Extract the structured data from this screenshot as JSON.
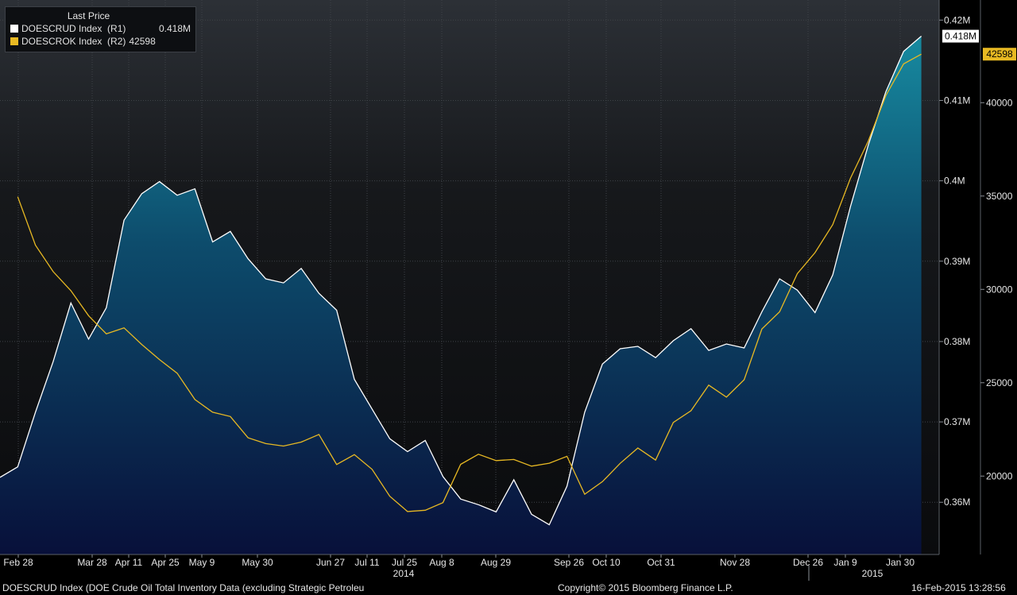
{
  "legend": {
    "header": "Last Price",
    "items": [
      {
        "name": "DOESCRUD Index  (R1)",
        "value": "0.418M",
        "color": "#ffffff"
      },
      {
        "name": "DOESCROK Index  (R2)",
        "value": "42598",
        "color": "#e8b923"
      }
    ]
  },
  "footer": {
    "left": "DOESCRUD Index (DOE Crude Oil Total Inventory Data (excluding Strategic Petroleu",
    "center": "Copyright© 2015 Bloomberg Finance L.P.",
    "right": "16-Feb-2015 13:28:56"
  },
  "chart_data": {
    "type": "area",
    "x_ticks": [
      "Feb 28",
      "Mar 28",
      "Apr 11",
      "Apr 25",
      "May 9",
      "May 30",
      "Jun 27",
      "Jul 11",
      "Jul 25",
      "Aug 8",
      "Aug 29",
      "Sep 26",
      "Oct 10",
      "Oct 31",
      "Nov 28",
      "Dec 26",
      "Jan 9",
      "Jan 30"
    ],
    "year_labels": [
      "2014",
      "2015"
    ],
    "left_axis": {
      "min": 0.3535,
      "max": 0.4225,
      "ticks": [
        "0.36M",
        "0.37M",
        "0.38M",
        "0.39M",
        "0.4M",
        "0.41M",
        "0.42M"
      ]
    },
    "right_axis": {
      "min": 15800,
      "max": 45500,
      "ticks": [
        "20000",
        "25000",
        "30000",
        "35000",
        "40000"
      ]
    },
    "series": [
      {
        "name": "DOESCRUD Index  (R1)",
        "axis": "left",
        "color": "#ffffff",
        "last_label": "0.418M",
        "values": [
          0.3631,
          0.3644,
          0.3712,
          0.3775,
          0.3848,
          0.3803,
          0.3842,
          0.3951,
          0.3984,
          0.3999,
          0.3982,
          0.399,
          0.3924,
          0.3937,
          0.3903,
          0.3878,
          0.3873,
          0.3891,
          0.386,
          0.3839,
          0.3753,
          0.3716,
          0.3679,
          0.3663,
          0.3677,
          0.3632,
          0.3604,
          0.3597,
          0.3588,
          0.3628,
          0.3585,
          0.3572,
          0.362,
          0.3712,
          0.3772,
          0.3791,
          0.3794,
          0.378,
          0.3801,
          0.3816,
          0.3789,
          0.3797,
          0.3792,
          0.3837,
          0.3878,
          0.3864,
          0.3836,
          0.3883,
          0.3968,
          0.4044,
          0.4111,
          0.4161,
          0.418
        ]
      },
      {
        "name": "DOESCROK Index  (R2)",
        "axis": "right",
        "color": "#e8b923",
        "last_label": "42598",
        "values": [
          34960,
          32370,
          30950,
          29930,
          28590,
          27620,
          27940,
          27050,
          26240,
          25510,
          24100,
          23420,
          23190,
          22050,
          21740,
          21610,
          21820,
          22230,
          20620,
          21150,
          20360,
          18920,
          18100,
          18170,
          18580,
          20630,
          21170,
          20830,
          20890,
          20530,
          20690,
          21060,
          19030,
          19700,
          20680,
          21500,
          20860,
          22870,
          23500,
          24870,
          24230,
          25160,
          27880,
          28800,
          30840,
          31970,
          33470,
          35950,
          37930,
          40390,
          42080,
          42598
        ]
      }
    ]
  }
}
